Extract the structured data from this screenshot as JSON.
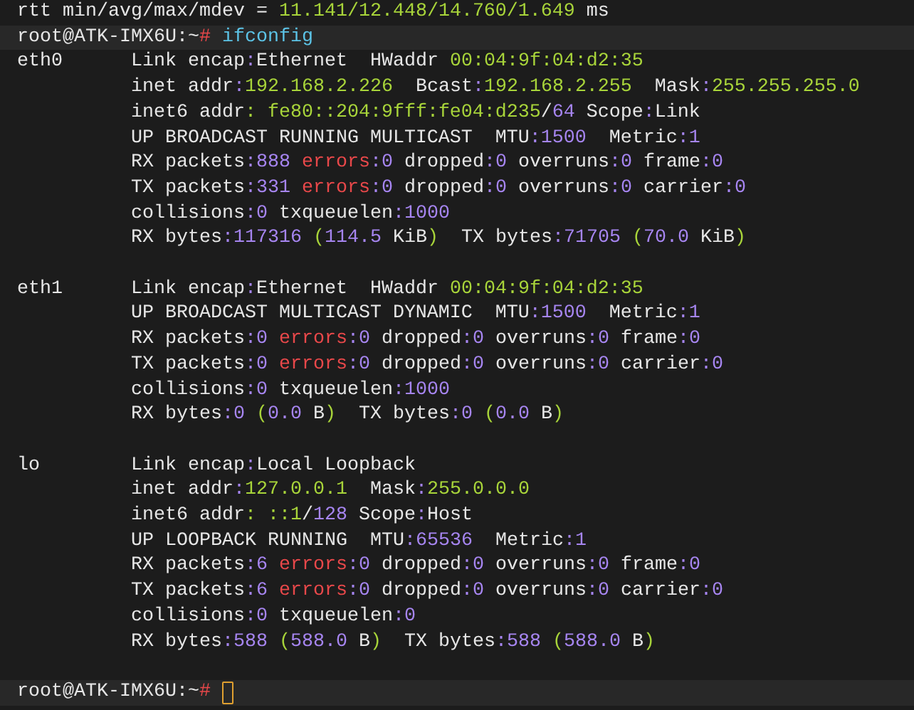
{
  "lines": [
    {
      "kind": "output",
      "segments": [
        {
          "text": "rtt min/avg/max/mdev = ",
          "kind": "label"
        },
        {
          "text": "11.141/12.448/14.760/1.649",
          "kind": "address"
        },
        {
          "text": " ms",
          "kind": "label"
        }
      ]
    },
    {
      "kind": "prompt",
      "segments": [
        {
          "text": "root@ATK-IMX6U:~",
          "kind": "label"
        },
        {
          "text": "#",
          "kind": "error"
        },
        {
          "text": " ifconfig",
          "kind": "command"
        }
      ]
    },
    {
      "kind": "output",
      "segments": [
        {
          "text": "eth0      Link encap",
          "kind": "label"
        },
        {
          "text": ":",
          "kind": "value"
        },
        {
          "text": "Ethernet  HWaddr ",
          "kind": "label"
        },
        {
          "text": "00:04:9f:04:d2:35",
          "kind": "address"
        }
      ]
    },
    {
      "kind": "output",
      "segments": [
        {
          "text": "          inet addr",
          "kind": "label"
        },
        {
          "text": ":",
          "kind": "value"
        },
        {
          "text": "192.168.2.226",
          "kind": "address"
        },
        {
          "text": "  Bcast",
          "kind": "label"
        },
        {
          "text": ":",
          "kind": "value"
        },
        {
          "text": "192.168.2.255",
          "kind": "address"
        },
        {
          "text": "  Mask",
          "kind": "label"
        },
        {
          "text": ":",
          "kind": "value"
        },
        {
          "text": "255.255.255.0",
          "kind": "address"
        }
      ]
    },
    {
      "kind": "output",
      "segments": [
        {
          "text": "          inet6 addr",
          "kind": "label"
        },
        {
          "text": ": fe80::204:9fff:fe04:d235",
          "kind": "address"
        },
        {
          "text": "/",
          "kind": "label"
        },
        {
          "text": "64",
          "kind": "value"
        },
        {
          "text": " Scope",
          "kind": "label"
        },
        {
          "text": ":",
          "kind": "value"
        },
        {
          "text": "Link",
          "kind": "label"
        }
      ]
    },
    {
      "kind": "output",
      "segments": [
        {
          "text": "          UP BROADCAST RUNNING MULTICAST  MTU",
          "kind": "label"
        },
        {
          "text": ":1500",
          "kind": "value"
        },
        {
          "text": "  Metric",
          "kind": "label"
        },
        {
          "text": ":1",
          "kind": "value"
        }
      ]
    },
    {
      "kind": "output",
      "segments": [
        {
          "text": "          RX packets",
          "kind": "label"
        },
        {
          "text": ":888 ",
          "kind": "value"
        },
        {
          "text": "errors",
          "kind": "error"
        },
        {
          "text": ":0",
          "kind": "value"
        },
        {
          "text": " dropped",
          "kind": "label"
        },
        {
          "text": ":0",
          "kind": "value"
        },
        {
          "text": " overruns",
          "kind": "label"
        },
        {
          "text": ":0",
          "kind": "value"
        },
        {
          "text": " frame",
          "kind": "label"
        },
        {
          "text": ":0",
          "kind": "value"
        }
      ]
    },
    {
      "kind": "output",
      "segments": [
        {
          "text": "          TX packets",
          "kind": "label"
        },
        {
          "text": ":331 ",
          "kind": "value"
        },
        {
          "text": "errors",
          "kind": "error"
        },
        {
          "text": ":0",
          "kind": "value"
        },
        {
          "text": " dropped",
          "kind": "label"
        },
        {
          "text": ":0",
          "kind": "value"
        },
        {
          "text": " overruns",
          "kind": "label"
        },
        {
          "text": ":0",
          "kind": "value"
        },
        {
          "text": " carrier",
          "kind": "label"
        },
        {
          "text": ":0",
          "kind": "value"
        }
      ]
    },
    {
      "kind": "output",
      "segments": [
        {
          "text": "          collisions",
          "kind": "label"
        },
        {
          "text": ":0",
          "kind": "value"
        },
        {
          "text": " txqueuelen",
          "kind": "label"
        },
        {
          "text": ":1000",
          "kind": "value"
        }
      ]
    },
    {
      "kind": "output",
      "segments": [
        {
          "text": "          RX bytes",
          "kind": "label"
        },
        {
          "text": ":117316 ",
          "kind": "value"
        },
        {
          "text": "(",
          "kind": "address"
        },
        {
          "text": "114.5",
          "kind": "value"
        },
        {
          "text": " KiB",
          "kind": "label"
        },
        {
          "text": ")",
          "kind": "address"
        },
        {
          "text": "  TX bytes",
          "kind": "label"
        },
        {
          "text": ":71705 ",
          "kind": "value"
        },
        {
          "text": "(",
          "kind": "address"
        },
        {
          "text": "70.0",
          "kind": "value"
        },
        {
          "text": " KiB",
          "kind": "label"
        },
        {
          "text": ")",
          "kind": "address"
        }
      ]
    },
    {
      "kind": "blank"
    },
    {
      "kind": "output",
      "segments": [
        {
          "text": "eth1      Link encap",
          "kind": "label"
        },
        {
          "text": ":",
          "kind": "value"
        },
        {
          "text": "Ethernet  HWaddr ",
          "kind": "label"
        },
        {
          "text": "00:04:9f:04:d2:35",
          "kind": "address"
        }
      ]
    },
    {
      "kind": "output",
      "segments": [
        {
          "text": "          UP BROADCAST MULTICAST DYNAMIC  MTU",
          "kind": "label"
        },
        {
          "text": ":1500",
          "kind": "value"
        },
        {
          "text": "  Metric",
          "kind": "label"
        },
        {
          "text": ":1",
          "kind": "value"
        }
      ]
    },
    {
      "kind": "output",
      "segments": [
        {
          "text": "          RX packets",
          "kind": "label"
        },
        {
          "text": ":0 ",
          "kind": "value"
        },
        {
          "text": "errors",
          "kind": "error"
        },
        {
          "text": ":0",
          "kind": "value"
        },
        {
          "text": " dropped",
          "kind": "label"
        },
        {
          "text": ":0",
          "kind": "value"
        },
        {
          "text": " overruns",
          "kind": "label"
        },
        {
          "text": ":0",
          "kind": "value"
        },
        {
          "text": " frame",
          "kind": "label"
        },
        {
          "text": ":0",
          "kind": "value"
        }
      ]
    },
    {
      "kind": "output",
      "segments": [
        {
          "text": "          TX packets",
          "kind": "label"
        },
        {
          "text": ":0 ",
          "kind": "value"
        },
        {
          "text": "errors",
          "kind": "error"
        },
        {
          "text": ":0",
          "kind": "value"
        },
        {
          "text": " dropped",
          "kind": "label"
        },
        {
          "text": ":0",
          "kind": "value"
        },
        {
          "text": " overruns",
          "kind": "label"
        },
        {
          "text": ":0",
          "kind": "value"
        },
        {
          "text": " carrier",
          "kind": "label"
        },
        {
          "text": ":0",
          "kind": "value"
        }
      ]
    },
    {
      "kind": "output",
      "segments": [
        {
          "text": "          collisions",
          "kind": "label"
        },
        {
          "text": ":0",
          "kind": "value"
        },
        {
          "text": " txqueuelen",
          "kind": "label"
        },
        {
          "text": ":1000",
          "kind": "value"
        }
      ]
    },
    {
      "kind": "output",
      "segments": [
        {
          "text": "          RX bytes",
          "kind": "label"
        },
        {
          "text": ":0 ",
          "kind": "value"
        },
        {
          "text": "(",
          "kind": "address"
        },
        {
          "text": "0.0",
          "kind": "value"
        },
        {
          "text": " B",
          "kind": "label"
        },
        {
          "text": ")",
          "kind": "address"
        },
        {
          "text": "  TX bytes",
          "kind": "label"
        },
        {
          "text": ":0 ",
          "kind": "value"
        },
        {
          "text": "(",
          "kind": "address"
        },
        {
          "text": "0.0",
          "kind": "value"
        },
        {
          "text": " B",
          "kind": "label"
        },
        {
          "text": ")",
          "kind": "address"
        }
      ]
    },
    {
      "kind": "blank"
    },
    {
      "kind": "output",
      "segments": [
        {
          "text": "lo        Link encap",
          "kind": "label"
        },
        {
          "text": ":",
          "kind": "value"
        },
        {
          "text": "Local Loopback",
          "kind": "label"
        }
      ]
    },
    {
      "kind": "output",
      "segments": [
        {
          "text": "          inet addr",
          "kind": "label"
        },
        {
          "text": ":",
          "kind": "value"
        },
        {
          "text": "127.0.0.1",
          "kind": "address"
        },
        {
          "text": "  Mask",
          "kind": "label"
        },
        {
          "text": ":",
          "kind": "value"
        },
        {
          "text": "255.0.0.0",
          "kind": "address"
        }
      ]
    },
    {
      "kind": "output",
      "segments": [
        {
          "text": "          inet6 addr",
          "kind": "label"
        },
        {
          "text": ": ::1",
          "kind": "address"
        },
        {
          "text": "/",
          "kind": "label"
        },
        {
          "text": "128",
          "kind": "value"
        },
        {
          "text": " Scope",
          "kind": "label"
        },
        {
          "text": ":",
          "kind": "value"
        },
        {
          "text": "Host",
          "kind": "label"
        }
      ]
    },
    {
      "kind": "output",
      "segments": [
        {
          "text": "          UP LOOPBACK RUNNING  MTU",
          "kind": "label"
        },
        {
          "text": ":65536",
          "kind": "value"
        },
        {
          "text": "  Metric",
          "kind": "label"
        },
        {
          "text": ":1",
          "kind": "value"
        }
      ]
    },
    {
      "kind": "output",
      "segments": [
        {
          "text": "          RX packets",
          "kind": "label"
        },
        {
          "text": ":6 ",
          "kind": "value"
        },
        {
          "text": "errors",
          "kind": "error"
        },
        {
          "text": ":0",
          "kind": "value"
        },
        {
          "text": " dropped",
          "kind": "label"
        },
        {
          "text": ":0",
          "kind": "value"
        },
        {
          "text": " overruns",
          "kind": "label"
        },
        {
          "text": ":0",
          "kind": "value"
        },
        {
          "text": " frame",
          "kind": "label"
        },
        {
          "text": ":0",
          "kind": "value"
        }
      ]
    },
    {
      "kind": "output",
      "segments": [
        {
          "text": "          TX packets",
          "kind": "label"
        },
        {
          "text": ":6 ",
          "kind": "value"
        },
        {
          "text": "errors",
          "kind": "error"
        },
        {
          "text": ":0",
          "kind": "value"
        },
        {
          "text": " dropped",
          "kind": "label"
        },
        {
          "text": ":0",
          "kind": "value"
        },
        {
          "text": " overruns",
          "kind": "label"
        },
        {
          "text": ":0",
          "kind": "value"
        },
        {
          "text": " carrier",
          "kind": "label"
        },
        {
          "text": ":0",
          "kind": "value"
        }
      ]
    },
    {
      "kind": "output",
      "segments": [
        {
          "text": "          collisions",
          "kind": "label"
        },
        {
          "text": ":0",
          "kind": "value"
        },
        {
          "text": " txqueuelen",
          "kind": "label"
        },
        {
          "text": ":0",
          "kind": "value"
        }
      ]
    },
    {
      "kind": "output",
      "segments": [
        {
          "text": "          RX bytes",
          "kind": "label"
        },
        {
          "text": ":588 ",
          "kind": "value"
        },
        {
          "text": "(",
          "kind": "address"
        },
        {
          "text": "588.0",
          "kind": "value"
        },
        {
          "text": " B",
          "kind": "label"
        },
        {
          "text": ")",
          "kind": "address"
        },
        {
          "text": "  TX bytes",
          "kind": "label"
        },
        {
          "text": ":588 ",
          "kind": "value"
        },
        {
          "text": "(",
          "kind": "address"
        },
        {
          "text": "588.0",
          "kind": "value"
        },
        {
          "text": " B",
          "kind": "label"
        },
        {
          "text": ")",
          "kind": "address"
        }
      ]
    },
    {
      "kind": "blank"
    },
    {
      "kind": "prompt",
      "cursor": true,
      "segments": [
        {
          "text": "root@ATK-IMX6U:~",
          "kind": "label"
        },
        {
          "text": "#",
          "kind": "error"
        }
      ]
    }
  ]
}
